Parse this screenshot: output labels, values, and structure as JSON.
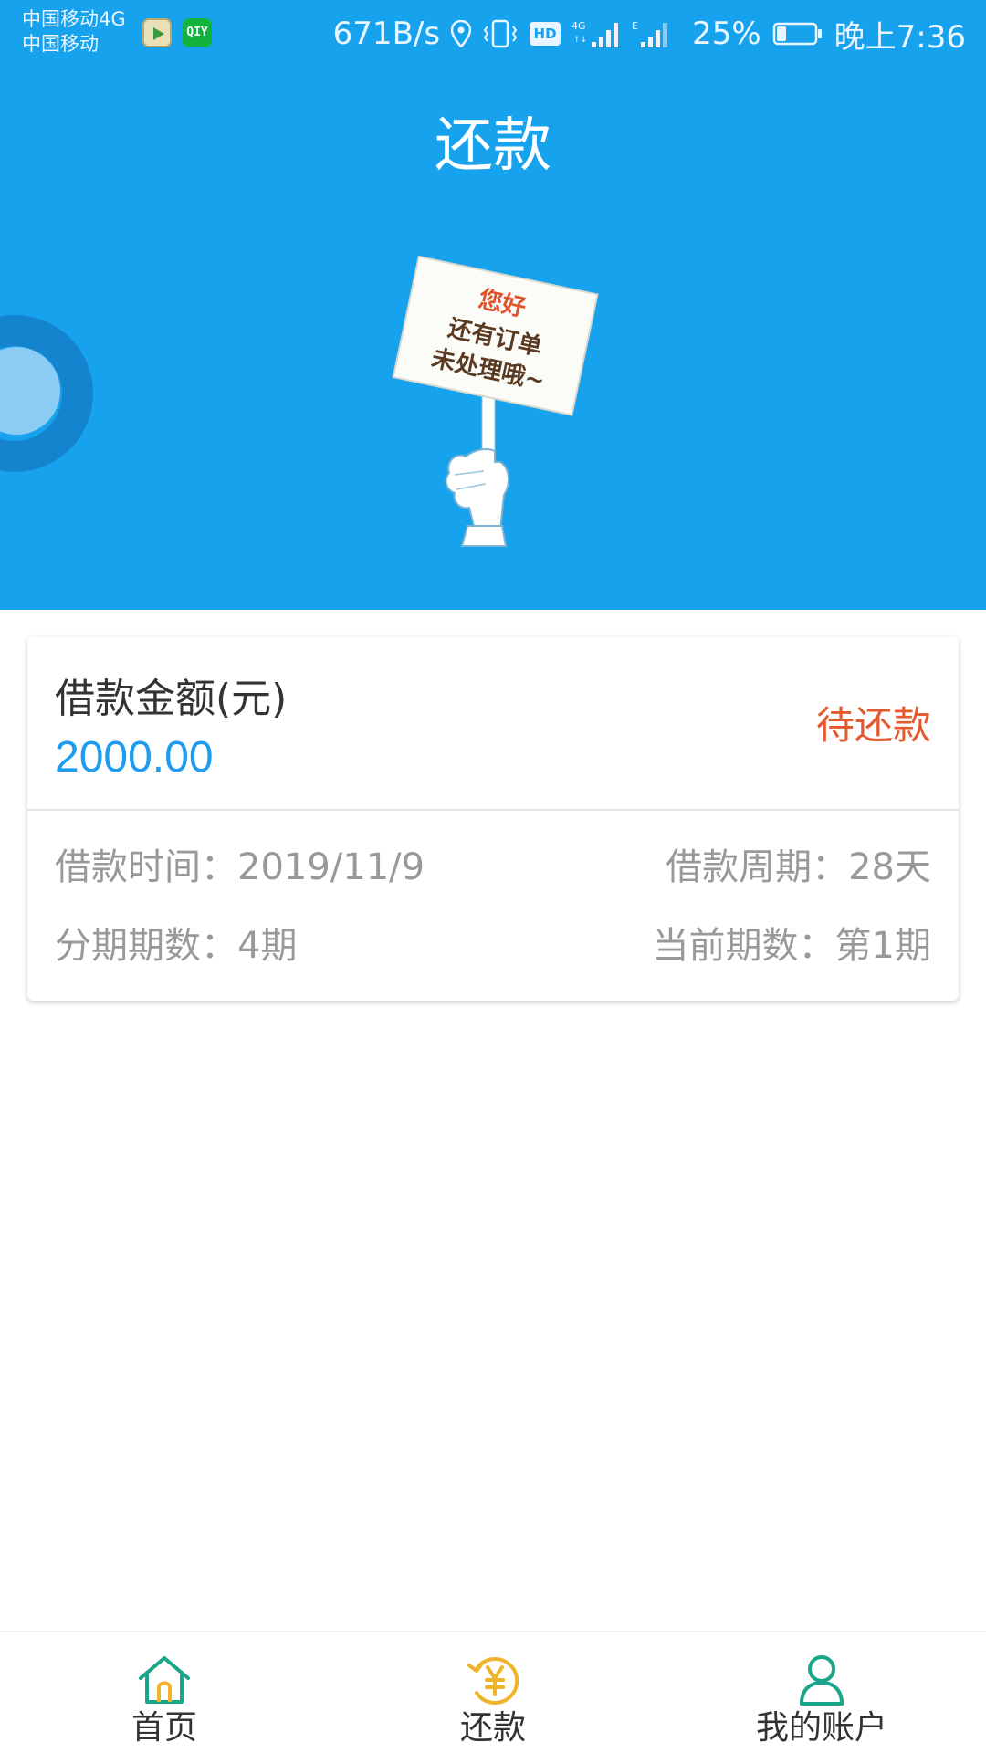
{
  "status_bar": {
    "carrier_line1": "中国移动4G",
    "carrier_line2": "中国移动",
    "app_icon_2_text": "QIY",
    "net_speed": "671B/s",
    "hd_label": "HD",
    "battery_percent": "25%",
    "battery_level": 0.25,
    "time": "晚上7:36",
    "icons": [
      "video-app-icon",
      "iqiyi-icon",
      "location-icon",
      "vibrate-icon",
      "hd-icon",
      "signal-4g-icon",
      "signal-e-icon",
      "battery-icon"
    ]
  },
  "header": {
    "title": "还款",
    "background_color": "#17a2ee",
    "sign": {
      "line1": "您好",
      "line2": "还有订单",
      "line3": "未处理哦~"
    }
  },
  "loan_card": {
    "amount_label": "借款金额(元)",
    "amount_value": "2000.00",
    "status": "待还款",
    "borrow_time_label": "借款时间：",
    "borrow_time_value": "2019/11/9",
    "borrow_period_label": "借款周期：",
    "borrow_period_value": "28天",
    "installments_label": "分期期数：",
    "installments_value": "4期",
    "current_label": "当前期数：",
    "current_value": "第1期",
    "colors": {
      "amount": "#1e9cf0",
      "status": "#e6582e",
      "info": "#999999"
    }
  },
  "bottom_nav": {
    "items": [
      {
        "label": "首页",
        "icon": "home-icon",
        "color": "#1aa68a"
      },
      {
        "label": "还款",
        "icon": "repay-yen-icon",
        "color": "#f0b32c"
      },
      {
        "label": "我的账户",
        "icon": "user-icon",
        "color": "#1aa68a"
      }
    ]
  }
}
